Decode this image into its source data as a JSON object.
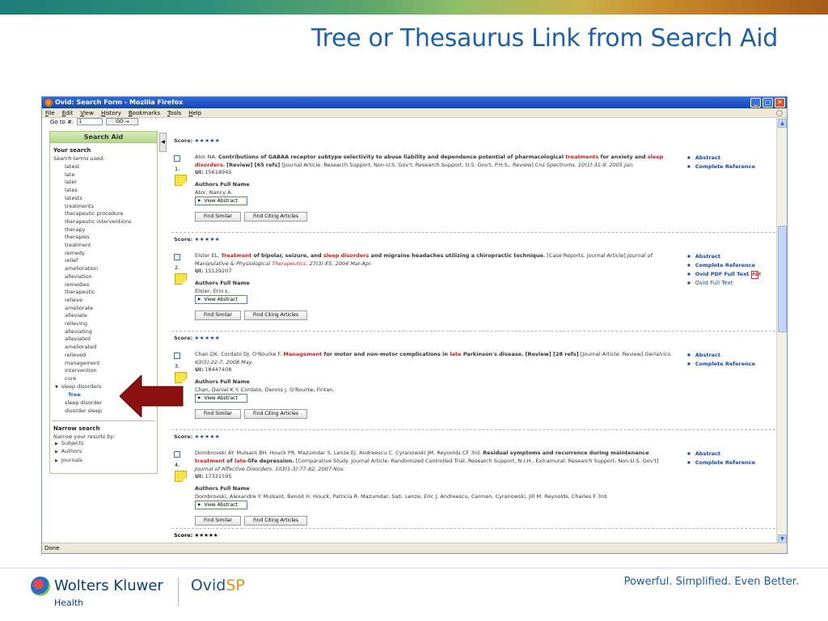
{
  "slide": {
    "title": "Tree or Thesaurus Link from Search Aid",
    "brand_name": "Wolters Kluwer",
    "brand_sub": "Health",
    "product_a": "Ovid",
    "product_b": "SP",
    "tagline": "Powerful. Simplified. Even Better."
  },
  "browser": {
    "title": "Ovid: Search Form - Mozilla Firefox",
    "menu": [
      "File",
      "Edit",
      "View",
      "History",
      "Bookmarks",
      "Tools",
      "Help"
    ],
    "status": "Done",
    "goto_label": "Go to #:",
    "goto_value": "1",
    "go_button": "GO →"
  },
  "search_aid": {
    "header": "Search Aid",
    "your_search": "Your search",
    "terms_used": "Search terms used:",
    "terms": [
      "latest",
      "late",
      "later",
      "lates",
      "latests",
      "treatments",
      "therapeutic procedure",
      "therapeutic interventions",
      "therapy",
      "therapies",
      "treatment",
      "remedy",
      "relief",
      "amelioration",
      "alleviation",
      "remedies",
      "therapeutic",
      "relieve",
      "ameliorate",
      "alleviate",
      "relieving",
      "alleviating",
      "alleviated",
      "ameliorated",
      "relieved",
      "management",
      "intervention",
      "cure"
    ],
    "expanded": "sleep disorders",
    "tree_link": "Tree",
    "after": [
      "sleep disorder",
      "disorder sleep"
    ],
    "narrow_title": "Narrow search",
    "narrow_sub": "Narrow your results by:",
    "narrow": [
      "Subjects",
      "Authors",
      "Journals"
    ]
  },
  "labels": {
    "score": "Score:",
    "stars": "★★★★★",
    "authors_full": "Authors Full Name",
    "view_abstract": "View Abstract",
    "find_similar": "Find Similar",
    "find_citing": "Find Citing Articles",
    "ui": "UI:"
  },
  "results": [
    {
      "num": "1.",
      "authors": "Ator NA.",
      "title_parts": [
        "Contributions of GABAA receptor subtype selectivity to abuse liability and dependence potential of pharmacological ",
        "treatments",
        " for anxiety and ",
        "sleep disorders",
        "."
      ],
      "type": "[Review] [65 refs]",
      "pubtype": " [Journal Article. Research Support, Non-U.S. Gov't. Research Support, U.S. Gov't, P.H.S.. Review] ",
      "source": "Cns Spectrums. 10(1):31-9, 2005 Jan.",
      "ui": "15618945",
      "full_name": "Ator, Nancy A.",
      "links": [
        "Abstract",
        "Complete Reference"
      ]
    },
    {
      "num": "2.",
      "authors": "Elster EL.",
      "title_parts": [
        "",
        "Treatment",
        " of bipolar, seizure, and ",
        "sleep disorders",
        " and migraine headaches utilizing a chiropractic technique."
      ],
      "type": "",
      "pubtype": " [Case Reports. Journal Article] ",
      "source_parts": [
        "Journal of Manipulative & Physiological ",
        "Therapeutics",
        ". 27(3):E5, 2004 Mar-Apr."
      ],
      "ui": "15129207",
      "full_name": "Elster, Erin L.",
      "links": [
        "Abstract",
        "Complete Reference",
        "Ovid PDF Full Text",
        "Ovid Full Text"
      ]
    },
    {
      "num": "3.",
      "authors": "Chan DK. Cordato DJ. O'Rourke F.",
      "title_parts": [
        "",
        "Management",
        " for motor and non-motor complications in ",
        "late",
        " Parkinson's disease."
      ],
      "type": "[Review] [28 refs]",
      "pubtype": " [Journal Article. Review] ",
      "source": "Geriatrics. 63(5):22-7, 2008 May.",
      "ui": "18447408",
      "full_name": "Chan, Daniel K Y. Cordato, Dennis J. O'Rourke, Fintan.",
      "links": [
        "Abstract",
        "Complete Reference"
      ]
    },
    {
      "num": "4.",
      "authors": "Dombrovski AY. Mulsant BH. Houck PR. Mazumdar S. Lenze EJ. Andreescu C. Cyranowski JM. Reynolds CF 3rd.",
      "title_parts": [
        "Residual symptoms and recurrence during maintenance ",
        "treatment",
        " of ",
        "late",
        "-life depression."
      ],
      "type": "",
      "pubtype": " [Comparative Study. Journal Article. Randomized Controlled Trial. Research Support, N.I.H., Extramural. Research Support, Non-U.S. Gov't] ",
      "source": "Journal of Affective Disorders. 103(1-3):77-82, 2007 Nov.",
      "ui": "17321595",
      "full_name": "Dombrovski, Alexandre Y. Mulsant, Benoit H. Houck, Patricia R. Mazumdar, Sati. Lenze, Eric J. Andreescu, Carmen. Cyranowski, Jill M. Reynolds, Charles F 3rd.",
      "links": [
        "Abstract",
        "Complete Reference"
      ]
    }
  ],
  "colors": {
    "title": "#1f5fa8",
    "highlight": "#d41c1c",
    "link": "#1a46b0",
    "arrow": "#8b1010"
  }
}
